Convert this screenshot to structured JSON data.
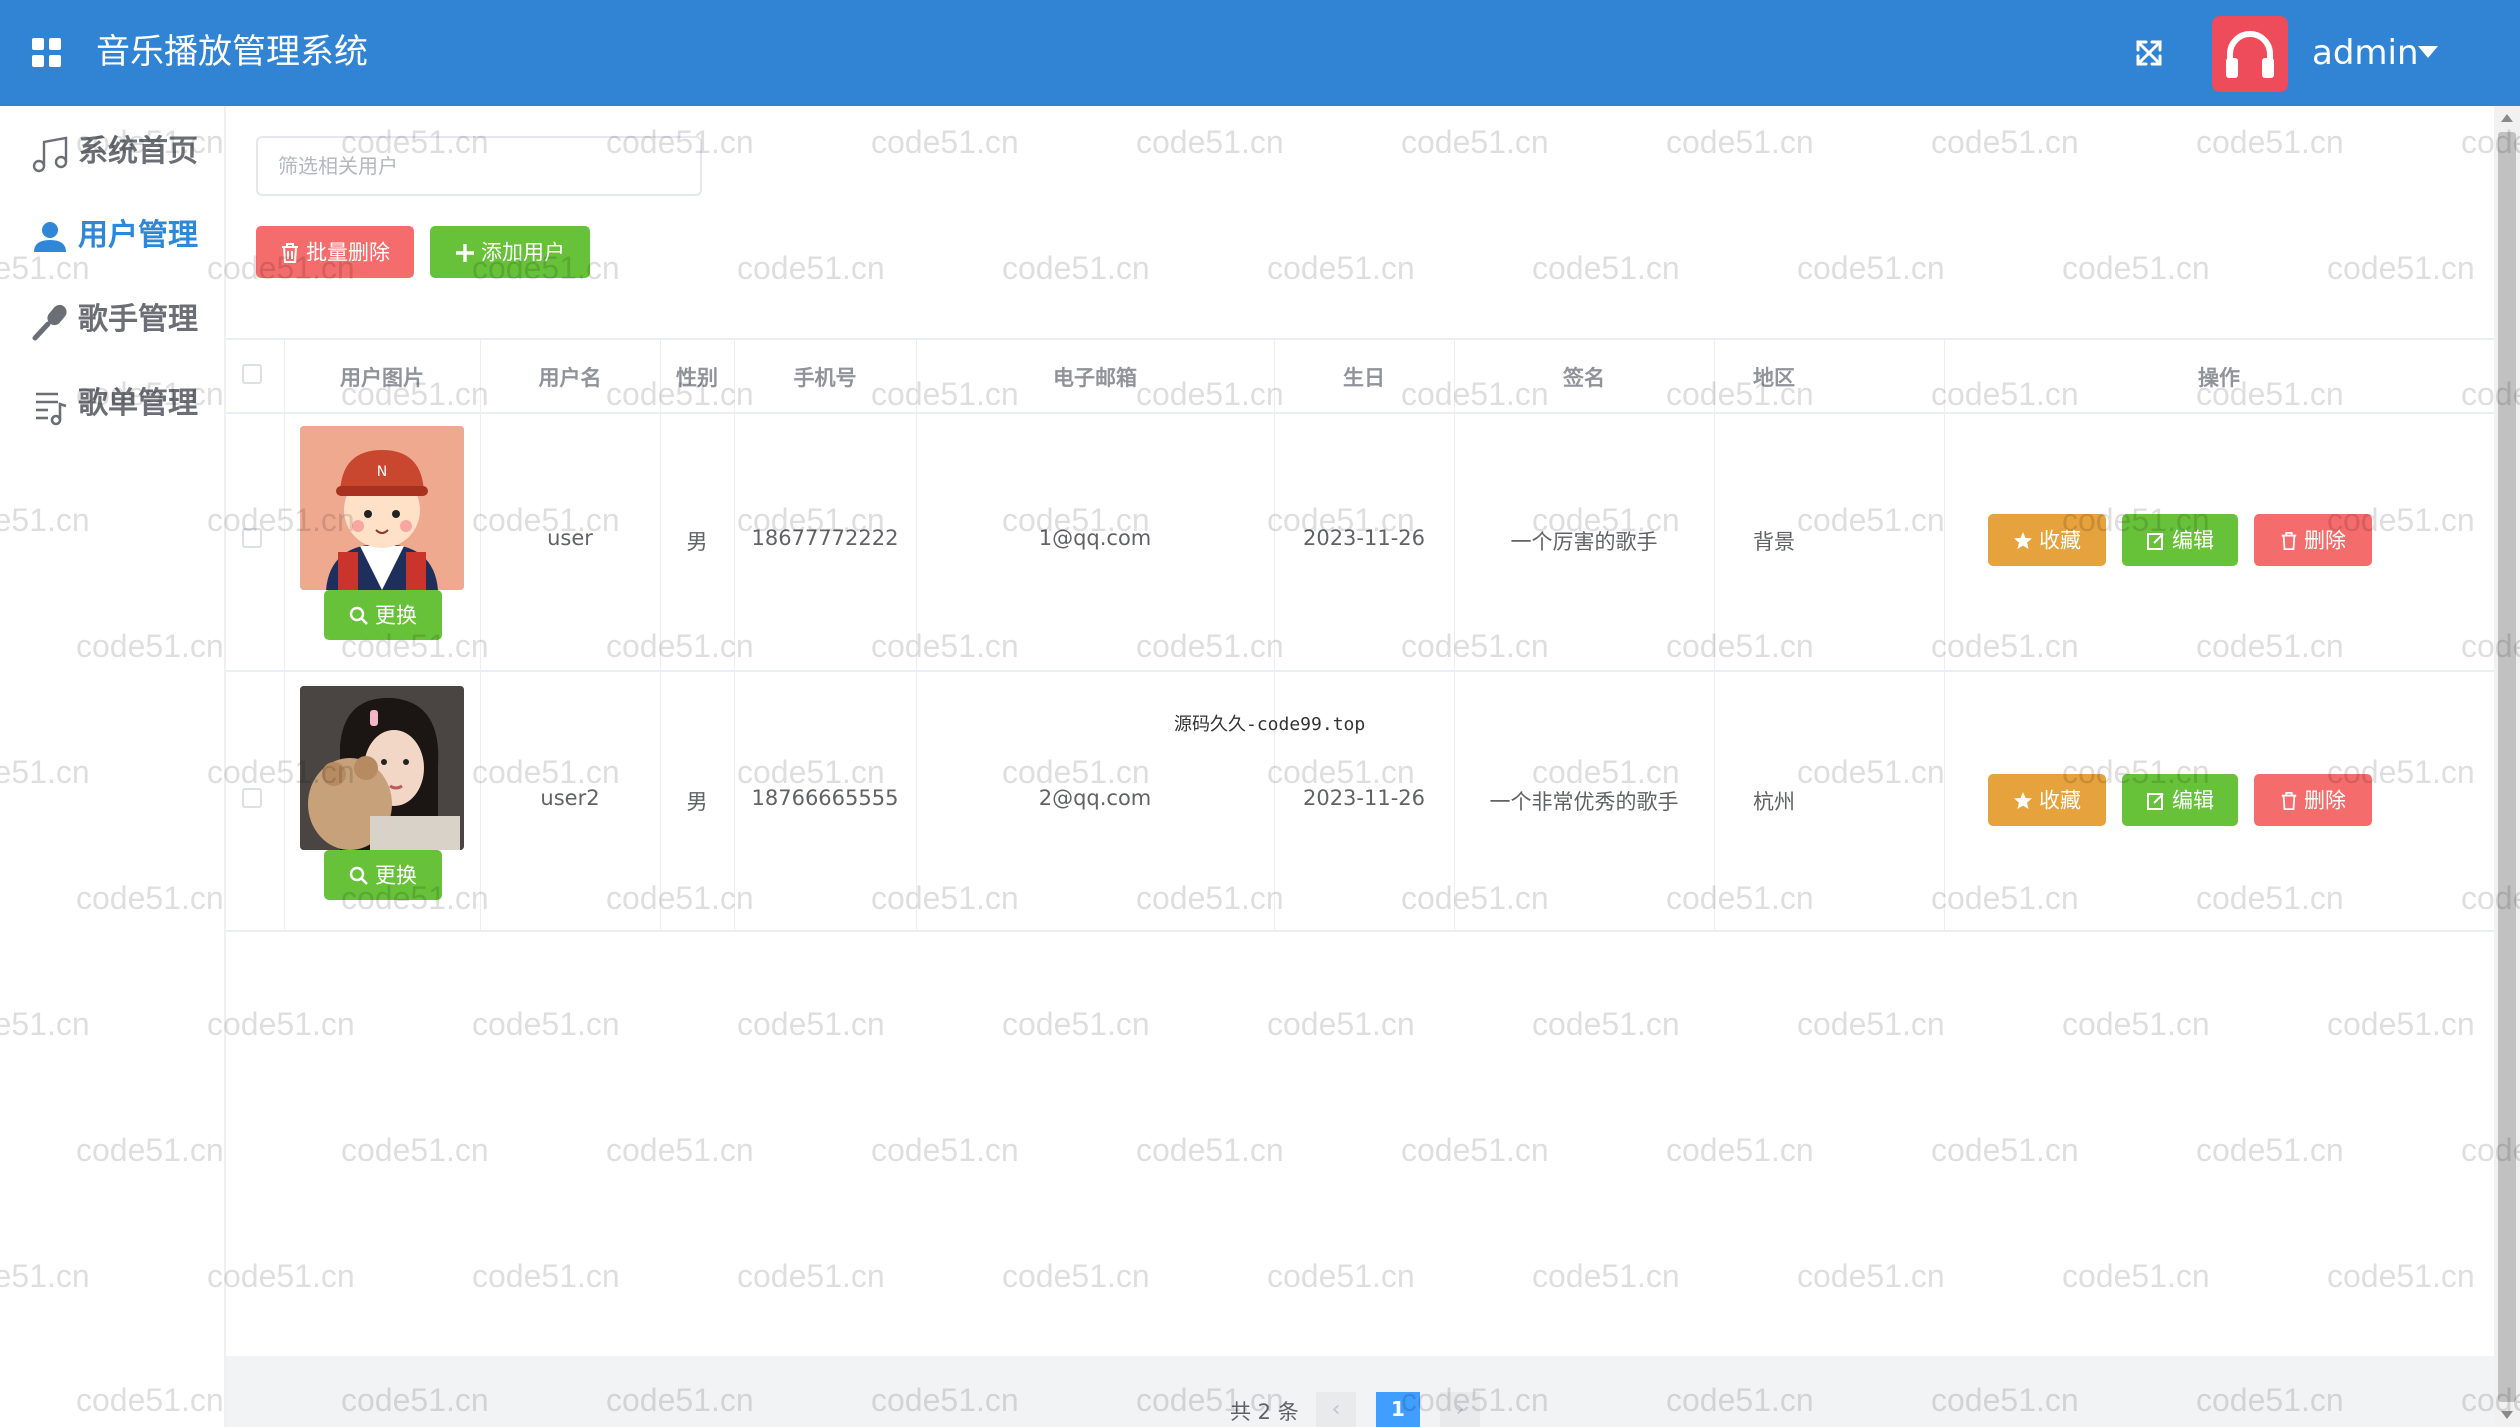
{
  "header": {
    "title": "音乐播放管理系统",
    "user_name": "admin",
    "colors": {
      "header_bg": "#3183d4",
      "headset_bg": "#ee4b5b"
    }
  },
  "sidebar": {
    "items": [
      {
        "label": "系统首页",
        "icon": "music-note-icon",
        "active": false
      },
      {
        "label": "用户管理",
        "icon": "user-icon",
        "active": true
      },
      {
        "label": "歌手管理",
        "icon": "microphone-icon",
        "active": false
      },
      {
        "label": "歌单管理",
        "icon": "playlist-icon",
        "active": false
      }
    ]
  },
  "toolbar": {
    "search_placeholder": "筛选相关用户",
    "batch_delete_label": "批量删除",
    "add_user_label": "添加用户"
  },
  "table": {
    "columns": [
      "用户图片",
      "用户名",
      "性别",
      "手机号",
      "电子邮箱",
      "生日",
      "签名",
      "地区",
      "操作"
    ],
    "change_label": "更换",
    "actions": {
      "favorite": "收藏",
      "edit": "编辑",
      "delete": "删除"
    },
    "rows": [
      {
        "avatar": "cartoon-boy",
        "username": "user",
        "gender": "男",
        "phone": "18677772222",
        "email": "1@qq.com",
        "birthday": "2023-11-26",
        "signature": "一个厉害的歌手",
        "region": "背景"
      },
      {
        "avatar": "girl-with-teddy-bear",
        "username": "user2",
        "gender": "男",
        "phone": "18766665555",
        "email": "2@qq.com",
        "birthday": "2023-11-26",
        "signature": "一个非常优秀的歌手",
        "region": "杭州"
      }
    ]
  },
  "pagination": {
    "total_text": "共 2 条",
    "current_page": "1",
    "prev": "‹",
    "next": "›"
  },
  "watermark_text": "code51.cn",
  "overlay_text": "源码久久-code99.top"
}
